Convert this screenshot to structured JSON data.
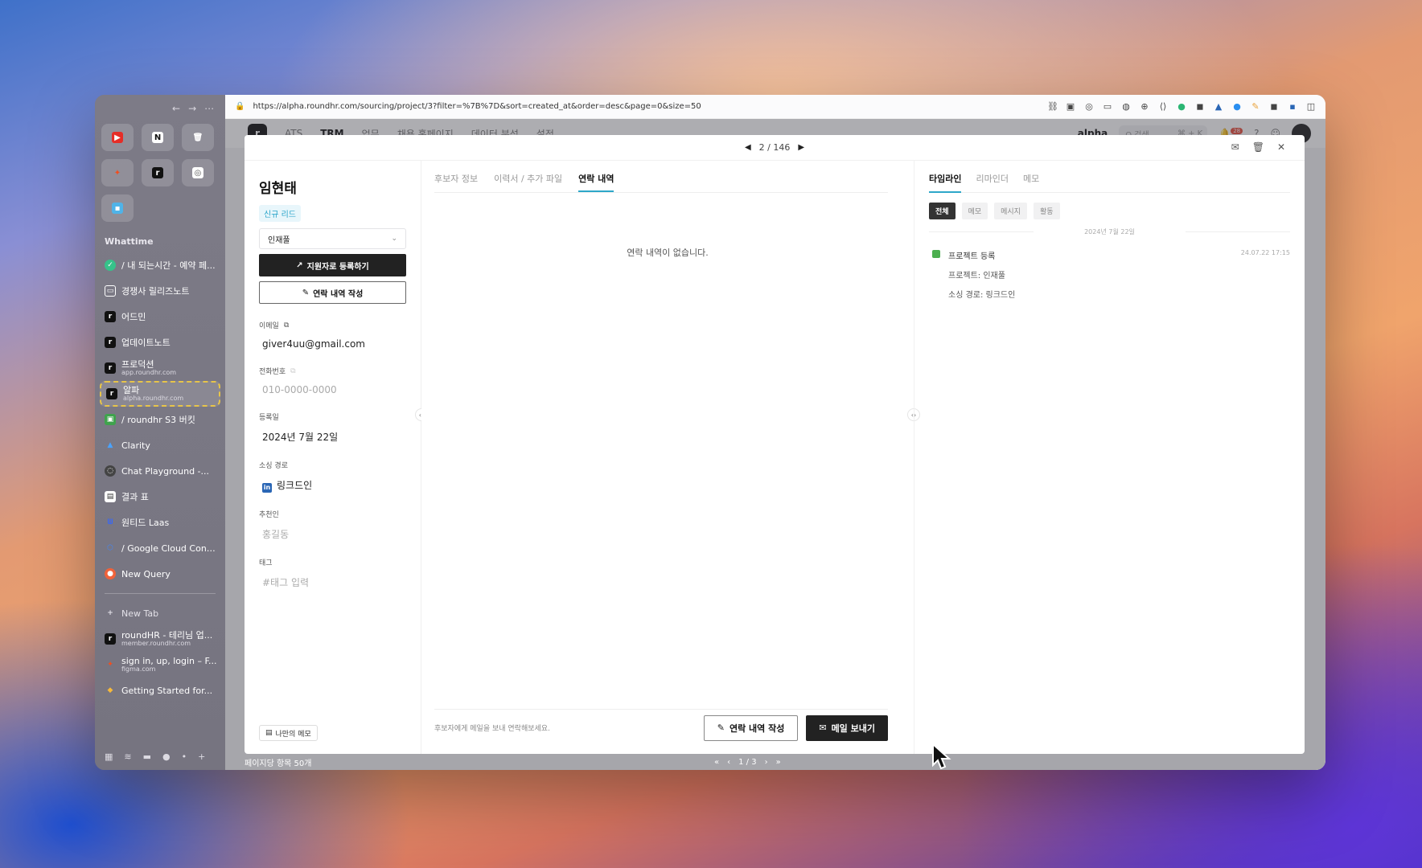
{
  "browser": {
    "url": "https://alpha.roundhr.com/sourcing/project/3?filter=%7B%7D&sort=created_at&order=desc&page=0&size=50"
  },
  "sidebar": {
    "space_label": "Whattime",
    "tabs": [
      {
        "label": "/ 내 되는시간 - 예약 페...",
        "sub": ""
      },
      {
        "label": "경쟁사 릴리즈노트",
        "sub": ""
      },
      {
        "label": "어드민",
        "sub": ""
      },
      {
        "label": "업데이트노트",
        "sub": ""
      },
      {
        "label": "프로덕션",
        "sub": "app.roundhr.com"
      },
      {
        "label": "알파",
        "sub": "alpha.roundhr.com"
      },
      {
        "label": "/ roundhr S3 버킷",
        "sub": ""
      },
      {
        "label": "Clarity",
        "sub": ""
      },
      {
        "label": "Chat Playground -...",
        "sub": ""
      },
      {
        "label": "결과 표",
        "sub": ""
      },
      {
        "label": "원티드 Laas",
        "sub": ""
      },
      {
        "label": "/ Google Cloud Cons...",
        "sub": ""
      },
      {
        "label": "New Query",
        "sub": ""
      }
    ],
    "new_tab": "New Tab",
    "lower_tabs": [
      {
        "label": "roundHR - 테리님 업...",
        "sub": "member.roundhr.com"
      },
      {
        "label": "sign in, up, login – F...",
        "sub": "figma.com"
      },
      {
        "label": "Getting Started for...",
        "sub": ""
      }
    ]
  },
  "app": {
    "nav": [
      "ATS",
      "TRM",
      "업무",
      "채용 홈페이지",
      "데이터 분석",
      "설정"
    ],
    "active_nav": "TRM",
    "workspace": "alpha",
    "search_placeholder": "Q 검색",
    "shortcut": "⌘ + K",
    "notif_count": "28",
    "per_page": "페이지당 항목 50개",
    "pager": "1 / 3"
  },
  "modal": {
    "counter": "2 / 146",
    "candidate": {
      "name": "임현태",
      "badge": "신규 리드",
      "project_select": "인재풀",
      "register_btn": "지원자로 등록하기",
      "contact_btn": "연락 내역 작성",
      "email_label": "이메일",
      "email": "giver4uu@gmail.com",
      "phone_label": "전화번호",
      "phone": "010-0000-0000",
      "registered_label": "등록일",
      "registered": "2024년 7월 22일",
      "source_label": "소싱 경로",
      "source": "링크드인",
      "referrer_label": "추천인",
      "referrer": "홍길동",
      "tag_label": "태그",
      "tag_placeholder": "#태그 입력",
      "memo_btn": "나만의 메모"
    },
    "middle": {
      "tabs": [
        "후보자 정보",
        "이력서 / 추가 파일",
        "연락 내역"
      ],
      "active_tab": "연락 내역",
      "empty": "연락 내역이 없습니다.",
      "hint": "후보자에게 메일을 보내 연락해보세요.",
      "write_btn": "연락 내역 작성",
      "mail_btn": "메일 보내기"
    },
    "right": {
      "tabs": [
        "타임라인",
        "리마인더",
        "메모"
      ],
      "active_tab": "타임라인",
      "filters": [
        "전체",
        "메모",
        "메시지",
        "활동"
      ],
      "active_filter": "전체",
      "date": "2024년 7월 22일",
      "event": {
        "title": "프로젝트 등록",
        "time": "24.07.22 17:15",
        "line1": "프로젝트: 인재풀",
        "line2": "소싱 경로: 링크드인"
      }
    }
  }
}
